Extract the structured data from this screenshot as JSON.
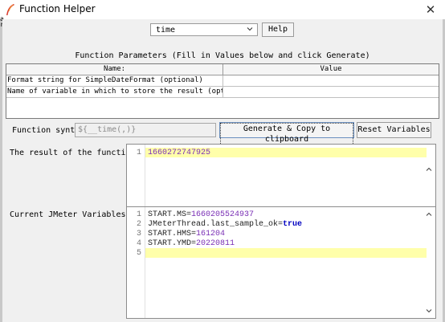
{
  "window": {
    "title": "Function Helper",
    "close_glyph": "✕",
    "icon": "feather-icon"
  },
  "background_fragment": "a\nr",
  "function_select": {
    "value": "time"
  },
  "help_button": "Help",
  "params": {
    "title": "Function Parameters (Fill in Values below and click Generate)",
    "header_name": "Name:",
    "header_value": "Value",
    "rows": [
      {
        "name": "Format string for SimpleDateFormat (optional)",
        "value": ""
      },
      {
        "name": "Name of variable in which to store the result (optio...",
        "value": ""
      }
    ]
  },
  "syntax": {
    "label": "Function syntax:",
    "value": "${__time(,)}"
  },
  "generate_button": "Generate & Copy to clipboard",
  "reset_button": "Reset Variables",
  "result": {
    "label": "The result of the function is",
    "lines": [
      {
        "num": "1",
        "value": "1660272747925"
      }
    ]
  },
  "variables": {
    "label": "Current JMeter Variables",
    "lines": [
      {
        "num": "1",
        "key": "START.MS=",
        "value": "1660205524937",
        "kind": "number"
      },
      {
        "num": "2",
        "key": "JMeterThread.last_sample_ok=",
        "value": "true",
        "kind": "keyword"
      },
      {
        "num": "3",
        "key": "START.HMS=",
        "value": "161204",
        "kind": "number"
      },
      {
        "num": "4",
        "key": "START.YMD=",
        "value": "20220811",
        "kind": "number"
      },
      {
        "num": "5",
        "key": "",
        "value": "",
        "kind": "none"
      }
    ]
  }
}
